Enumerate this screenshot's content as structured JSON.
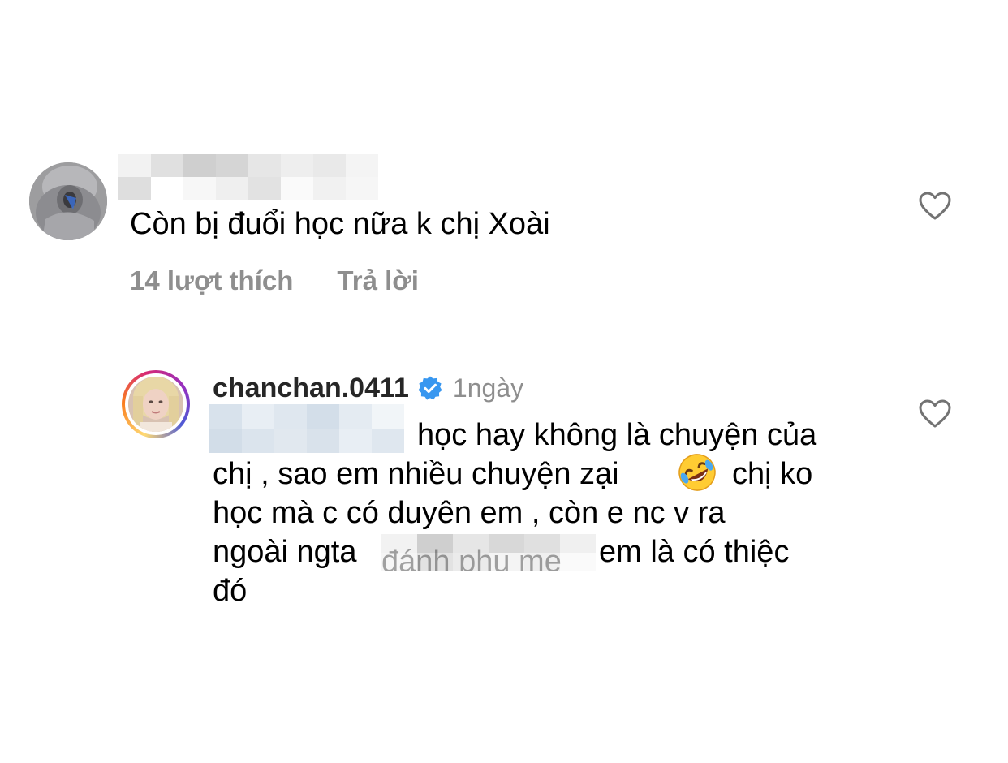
{
  "comments": [
    {
      "username_redacted": true,
      "text": "Còn bị đuổi học nữa k chị Xoài",
      "likes_label": "14 lượt thích",
      "reply_label": "Trả lời",
      "like_icon": "heart-outline-icon"
    }
  ],
  "reply": {
    "username": "chanchan.0411",
    "verified_icon": "verified-badge-icon",
    "time": "1ngày",
    "mention_redacted": true,
    "lines": [
      "học hay không là chuyện của",
      "chị , sao em nhiều chuyện zại",
      "chị ko",
      "học mà c có duyên em , còn e nc v ra",
      "ngoài ngta",
      "em là có thiệc",
      "đó"
    ],
    "redacted_fragment": "đánh phụ mẹ",
    "emoji": "rolling-on-the-floor-laughing-emoji",
    "like_icon": "heart-outline-icon"
  },
  "colors": {
    "text_primary": "#000000",
    "text_secondary": "#8e8e8e",
    "verified_blue": "#3897f0",
    "redaction_grays": [
      "#c9c9c9",
      "#d8d8d8",
      "#e6e6e6",
      "#f0f0f0"
    ],
    "redaction_blues": [
      "#d6e0ea",
      "#e3ebf2",
      "#edf2f7"
    ]
  }
}
